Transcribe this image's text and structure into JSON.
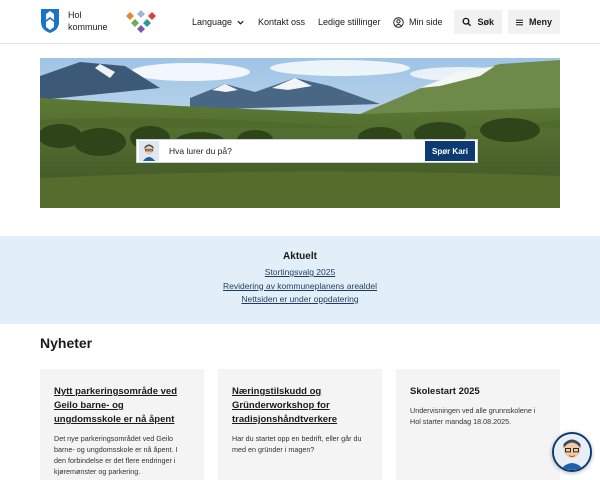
{
  "header": {
    "logo_line1": "Hol",
    "logo_line2": "kommune",
    "nav_language": "Language",
    "nav_contact": "Kontakt oss",
    "nav_jobs": "Ledige stillinger",
    "nav_mypage": "Min side",
    "search_label": "Søk",
    "menu_label": "Meny"
  },
  "hero": {
    "ask_placeholder": "Hva lurer du på?",
    "ask_button": "Spør Kari"
  },
  "aktuelt": {
    "title": "Aktuelt",
    "links": [
      "Stortingsvalg 2025",
      "Revidering av kommuneplanens arealdel",
      "Nettsiden er under oppdatering"
    ]
  },
  "news": {
    "title": "Nyheter",
    "cards": [
      {
        "title": "Nytt parkeringsområde ved Geilo barne- og ungdomsskole er nå åpent",
        "body": "Det nye parkeringsområdet ved Geilo barne- og ungdomsskole er nå åpent. I den forbindelse er det flere endringer i kjøremønster og parkering."
      },
      {
        "title": "Næringstilskudd og Gründerworkshop for tradisjonshåndtverkere",
        "body": "Har du startet opp en bedrift, eller går du med en gründer i magen?"
      },
      {
        "title": "Skolestart 2025",
        "body": "Undervisningen ved alle grunnskolene i Hol starter mandag 18.08.2025."
      }
    ]
  },
  "colors": {
    "brand_blue": "#0c3b73",
    "aktuelt_bg": "#e3eff8",
    "card_bg": "#f4f4f4"
  },
  "icons": [
    "hol-coat-of-arms-icon",
    "brand-diamonds-icon",
    "chevron-down-icon",
    "user-icon",
    "search-icon",
    "menu-icon",
    "kari-avatar-icon",
    "chat-bot-icon"
  ]
}
